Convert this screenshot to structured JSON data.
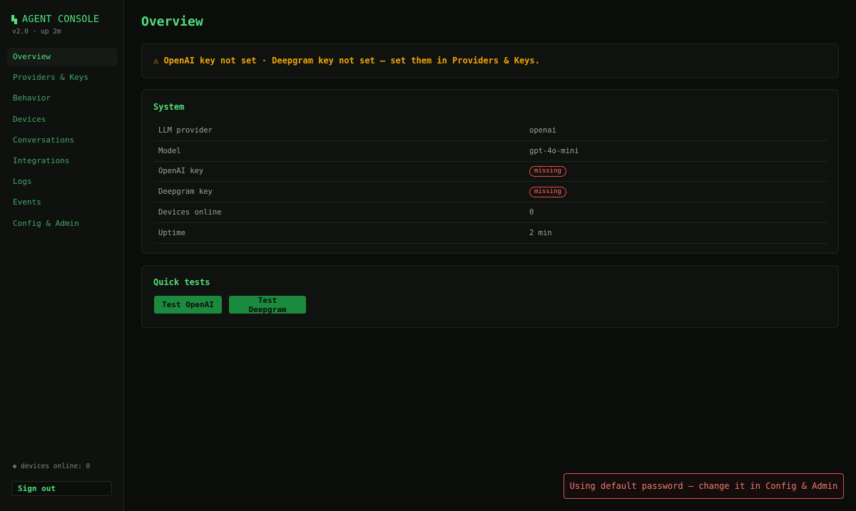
{
  "brand": {
    "title": "AGENT CONSOLE",
    "version": "v2.0 · up 2m"
  },
  "sidebar": {
    "items": [
      {
        "label": "Overview",
        "active": true
      },
      {
        "label": "Providers & Keys"
      },
      {
        "label": "Behavior"
      },
      {
        "label": "Devices"
      },
      {
        "label": "Conversations"
      },
      {
        "label": "Integrations"
      },
      {
        "label": "Logs"
      },
      {
        "label": "Events"
      },
      {
        "label": "Config & Admin"
      }
    ],
    "devices_online": "devices online: 0",
    "signout_label": "Sign out"
  },
  "main": {
    "title": "Overview",
    "alert": "⚠ OpenAI key not set · Deepgram key not set — set them in Providers & Keys.",
    "system": {
      "title": "System",
      "rows": [
        {
          "key": "LLM provider",
          "value": "openai"
        },
        {
          "key": "Model",
          "value": "gpt-4o-mini"
        },
        {
          "key": "OpenAI key",
          "badge": "missing"
        },
        {
          "key": "Deepgram key",
          "badge": "missing"
        },
        {
          "key": "Devices online",
          "value": "0"
        },
        {
          "key": "Uptime",
          "value": "2 min"
        }
      ]
    },
    "quick_tests": {
      "title": "Quick tests",
      "buttons": [
        "Test OpenAI",
        "Test Deepgram"
      ]
    }
  },
  "toast": "Using default password — change it in Config & Admin",
  "colors": {
    "accent": "#4ee07a",
    "warning": "#f0a30a",
    "danger": "#d9534a",
    "button": "#1c8a3e"
  }
}
